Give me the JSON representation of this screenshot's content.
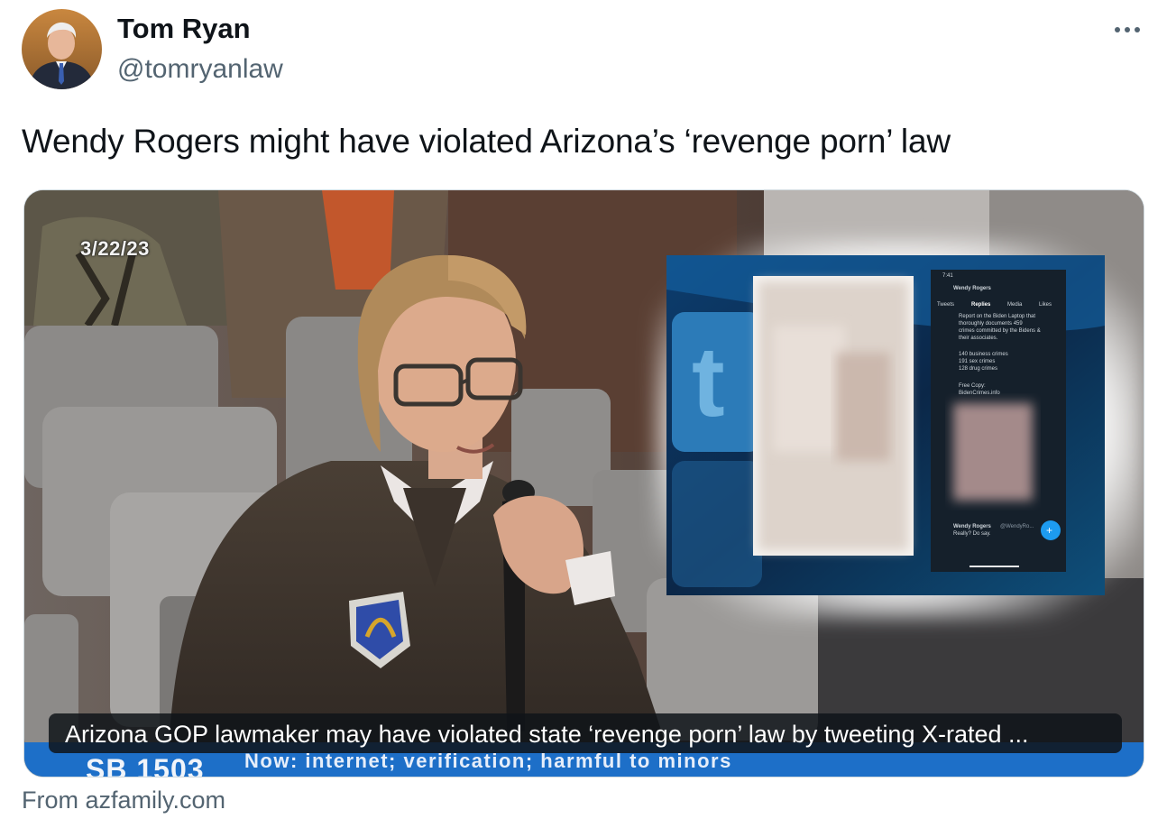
{
  "author": {
    "name": "Tom Ryan",
    "handle": "@tomryanlaw"
  },
  "tweet": {
    "text": "Wendy Rogers might have violated Arizona’s ‘revenge porn’ law"
  },
  "card": {
    "date_stamp": "3/22/23",
    "caption": "Arizona GOP lawmaker may have violated state ‘revenge porn’ law by tweeting X-rated ...",
    "bill_label": "SB 1503",
    "ticker": "Now: internet; verification; harmful to minors",
    "source": "From azfamily.com",
    "phone_screen": {
      "time": "7:41",
      "profile_name": "Wendy Rogers",
      "tabs": [
        "Tweets",
        "Replies",
        "Media",
        "Likes"
      ],
      "body_lines": [
        "Report on the Biden Laptop that",
        "thoroughly documents 459",
        "crimes committed by the Bidens &",
        "their associates."
      ],
      "stats_lines": [
        "140 business crimes",
        "191 sex crimes",
        "128 drug crimes"
      ],
      "copy_lines": [
        "Free Copy:",
        "BidenCrimes.info"
      ],
      "reply_name": "Wendy Rogers",
      "reply_handle": "@WendyRo...",
      "reply_text": "Really? Do say."
    }
  },
  "colors": {
    "text_primary": "#0f1419",
    "text_secondary": "#536471",
    "card_border": "#cfd9de",
    "tv_bar": "#1d6fc8",
    "twitter_blue": "#1d9bf0"
  },
  "icons": [
    "more-options-icon",
    "twitter-bird-icon",
    "compose-icon"
  ]
}
